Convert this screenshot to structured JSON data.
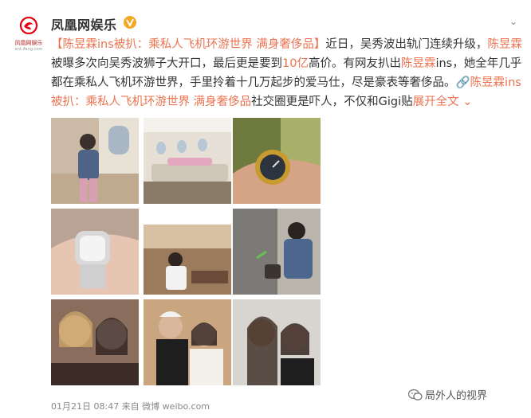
{
  "account": {
    "name": "凤凰网娱乐",
    "logo_text": "凤凰网娱乐",
    "logo_sub": "ent.ifeng.com",
    "verified_icon": "verified-v-icon",
    "brand_color": "#e60012"
  },
  "post": {
    "title_link": "【陈昱霖ins被扒：乘私人飞机环游世界 满身奢侈品】",
    "t1": "近日，吴秀波出轨门连续升级，",
    "name1": "陈昱霖",
    "t2": "被曝多次向吴秀波狮子大开口，最后更是要到",
    "amount": "10亿",
    "t3": "高价。有网友扒出",
    "name2": "陈昱霖",
    "t4": "ins，她全年几乎都在乘私人飞机环游世界，手里拎着十几万起步的爱马仕，尽是豪表等奢侈品。",
    "link2": "🔗陈昱霖ins被扒：乘私人飞机环游世界 满身奢侈品",
    "t5": "社交圈更是吓人，不仅和Gigi贴",
    "expand": "展开全文",
    "link_color": "#eb7350"
  },
  "footer": {
    "time_source": "01月21日 08:47 来自 微博 weibo.com"
  },
  "watermark": {
    "text": "局外人的视界"
  }
}
